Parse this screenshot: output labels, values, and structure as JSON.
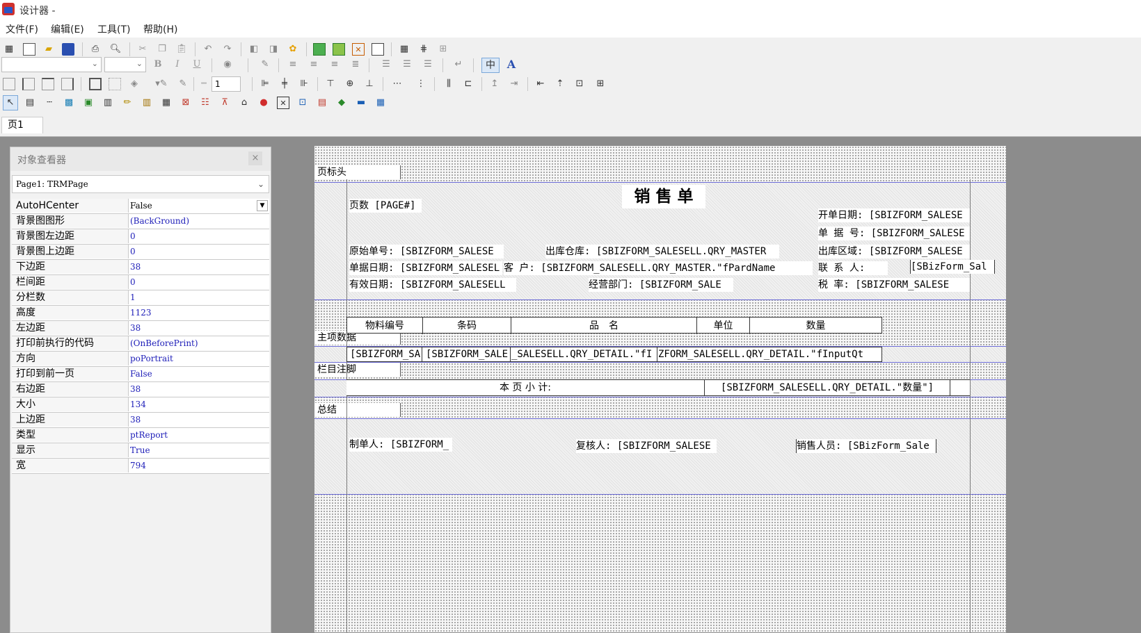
{
  "window": {
    "title": "设计器 -"
  },
  "menu": [
    "文件(F)",
    "编辑(E)",
    "工具(T)",
    "帮助(H)"
  ],
  "toolbar": {
    "row3_spin_value": "1",
    "row2_char_label": "中",
    "row2_font_color_label": "A",
    "bold": "B",
    "italic": "I",
    "underline": "U"
  },
  "tabs": [
    "页1"
  ],
  "inspector": {
    "title": "对象查看器",
    "close": "×",
    "object": "Page1: TRMPage",
    "properties": [
      {
        "name": "AutoHCenter",
        "value": "False"
      },
      {
        "name": "背景图图形",
        "value": "(BackGround)"
      },
      {
        "name": "背景图左边距",
        "value": "0"
      },
      {
        "name": "背景图上边距",
        "value": "0"
      },
      {
        "name": "下边距",
        "value": "38"
      },
      {
        "name": "栏间距",
        "value": "0"
      },
      {
        "name": "分栏数",
        "value": "1"
      },
      {
        "name": "高度",
        "value": "1123"
      },
      {
        "name": "左边距",
        "value": "38"
      },
      {
        "name": "打印前执行的代码",
        "value": "(OnBeforePrint)"
      },
      {
        "name": "方向",
        "value": "poPortrait"
      },
      {
        "name": "打印到前一页",
        "value": "False"
      },
      {
        "name": "右边距",
        "value": "38"
      },
      {
        "name": "大小",
        "value": "134"
      },
      {
        "name": "上边距",
        "value": "38"
      },
      {
        "name": "类型",
        "value": "ptReport"
      },
      {
        "name": "显示",
        "value": "True"
      },
      {
        "name": "宽",
        "value": "794"
      }
    ]
  },
  "report": {
    "bands": {
      "page_header": "页标头",
      "master_data": "主项数据",
      "column_footer": "栏目注脚",
      "summary": "总结"
    },
    "title": "销 售 单",
    "page_no": "页数 [PAGE#]",
    "header_fields": {
      "open_date": "开单日期: [SBIZFORM_SALESE",
      "doc_no": "单 据 号: [SBIZFORM_SALESE",
      "orig_no": "原始单号: [SBIZFORM_SALESE",
      "warehouse": "出库仓库: [SBIZFORM_SALESELL.QRY_MASTER",
      "region": "出库区域: [SBIZFORM_SALESE",
      "doc_date": "单据日期: [SBIZFORM_SALESEL",
      "customer": "客    户: [SBIZFORM_SALESELL.QRY_MASTER.\"fPardName",
      "contact": "联 系 人:",
      "contact_val": "[SBizForm_Sal",
      "valid_date": "有效日期: [SBIZFORM_SALESELL",
      "dept": "经营部门: [SBIZFORM_SALE",
      "tax": "税    率: [SBIZFORM_SALESE"
    },
    "columns": [
      "物料编号",
      "条码",
      "品　名",
      "单位",
      "数量"
    ],
    "detail_cells": [
      "[SBIZFORM_SA",
      "[SBIZFORM_SALE",
      "_SALESELL.QRY_DETAIL.\"fI",
      "ZFORM_SALESELL.QRY_DETAIL.\"fInputQt"
    ],
    "subtotal_label": "本   页   小   计:",
    "subtotal_value": "[SBIZFORM_SALESELL.QRY_DETAIL.\"数量\"]",
    "summary_fields": {
      "maker": "制单人: [SBIZFORM_",
      "reviewer": "复核人: [SBIZFORM_SALESE",
      "salesman": "销售人员: [SBizForm_Sale"
    }
  }
}
